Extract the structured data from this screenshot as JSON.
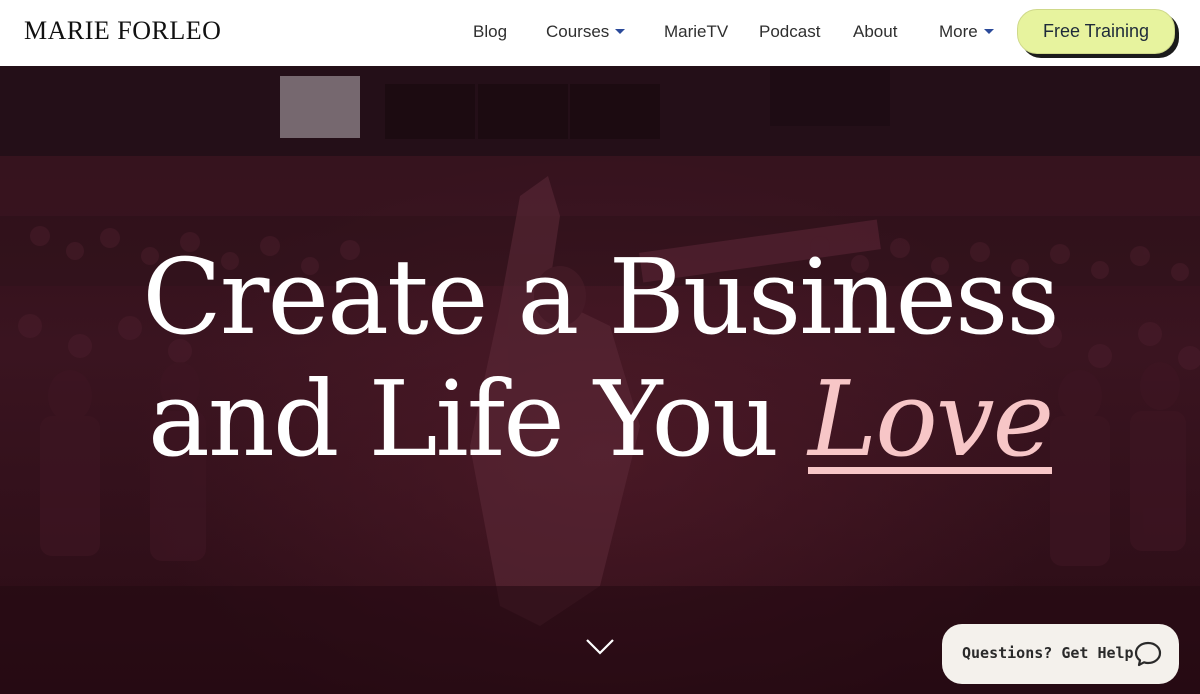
{
  "header": {
    "logo_text": "MARIE FORLEO",
    "nav": {
      "blog": "Blog",
      "courses": "Courses",
      "marietv": "MarieTV",
      "podcast": "Podcast",
      "about": "About",
      "more": "More"
    },
    "cta_label": "Free Training"
  },
  "hero": {
    "headline_line1": "Create a Business",
    "headline_line2_prefix": "and Life You ",
    "headline_emphasis": "Love"
  },
  "help_widget": {
    "label": "Questions? Get Help",
    "icon": "chat-bubble-icon"
  },
  "colors": {
    "header_bg": "#ffffff",
    "cta_bg": "#e7f39e",
    "hero_overlay": "#3a1420",
    "emphasis": "#f7c6c7",
    "caret": "#2b4a9a",
    "help_bg": "#f4f1ec"
  }
}
